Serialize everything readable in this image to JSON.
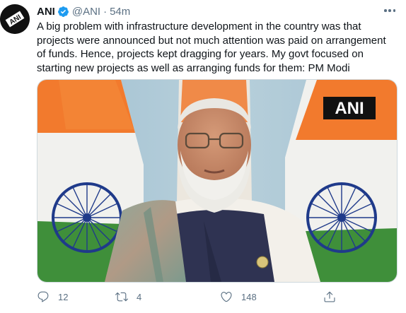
{
  "tweet": {
    "author_name": "ANI",
    "handle": "@ANI",
    "separator": "·",
    "time": "54m",
    "avatar_text": "ANI",
    "text": "A big problem with infrastructure development in the country was that\nprojects were announced but not much attention was paid on arrangement\nof funds. Hence, projects kept dragging for years. My govt focused on\nstarting new projects as well as arranging funds for them: PM Modi",
    "media": {
      "watermark": "ANI"
    },
    "actions": {
      "replies": "12",
      "retweets": "4",
      "likes": "148"
    }
  },
  "colors": {
    "text": "#0f1419",
    "secondary": "#5b7083",
    "verified": "#1d9bf0",
    "saffron": "#f27a2d",
    "green": "#3f8f3a",
    "chakra": "#1f3a8a"
  },
  "icons": [
    "verified-badge-icon",
    "more-icon",
    "reply-icon",
    "retweet-icon",
    "like-icon",
    "share-icon"
  ]
}
